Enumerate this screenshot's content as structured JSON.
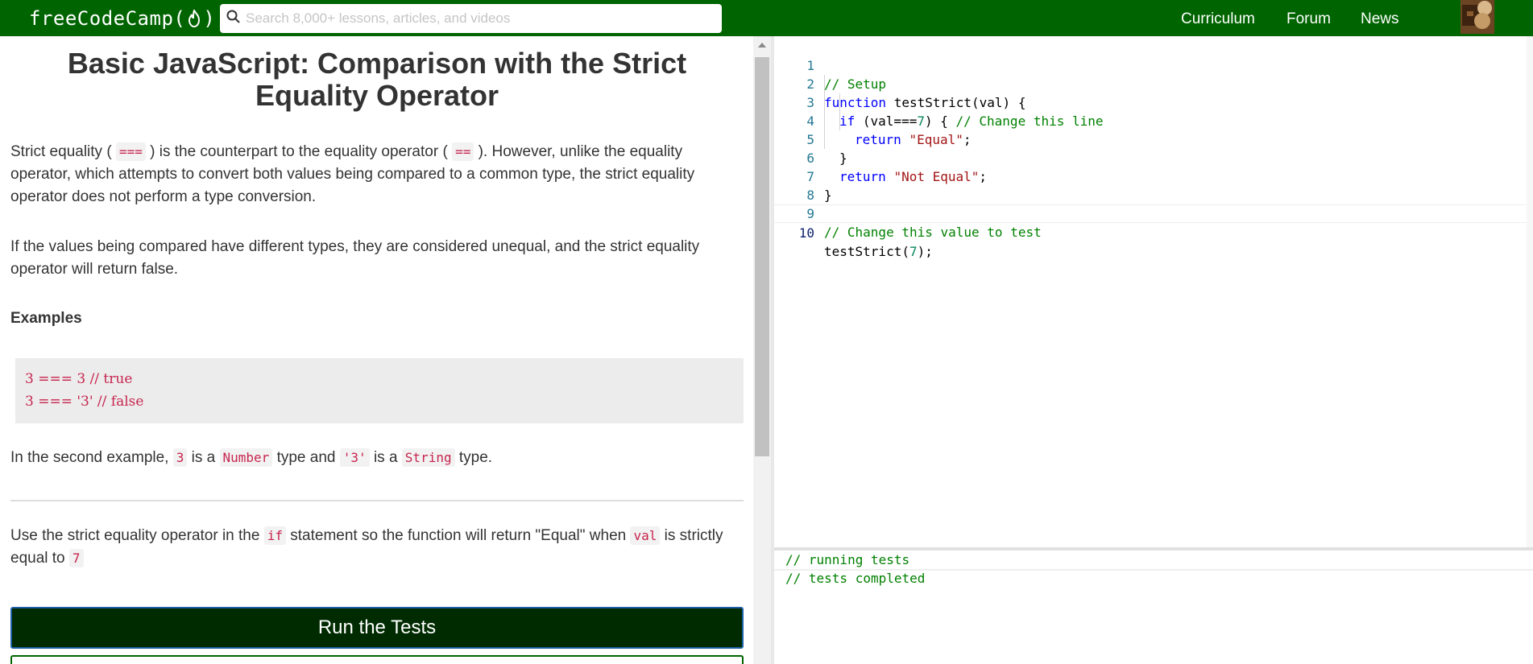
{
  "navbar": {
    "logo_text": "freeCodeCamp(",
    "logo_close": ")",
    "search_placeholder": "Search 8,000+ lessons, articles, and videos",
    "links": [
      "Curriculum",
      "Forum",
      "News"
    ]
  },
  "lesson": {
    "title": "Basic JavaScript: Comparison with the Strict Equality Operator",
    "p1_a": "Strict equality ( ",
    "p1_code1": "===",
    "p1_b": " ) is the counterpart to the equality operator ( ",
    "p1_code2": "==",
    "p1_c": " ). However, unlike the equality operator, which attempts to convert both values being compared to a common type, the strict equality operator does not perform a type conversion.",
    "p2": "If the values being compared have different types, they are considered unequal, and the strict equality operator will return false.",
    "examples_heading": "Examples",
    "code_line1": "3 === 3 // true",
    "code_line2": "3 === '3' // false",
    "p3_a": "In the second example, ",
    "p3_code1": "3",
    "p3_b": " is a ",
    "p3_code2": "Number",
    "p3_c": " type and ",
    "p3_code3": "'3'",
    "p3_d": " is a ",
    "p3_code4": "String",
    "p3_e": " type.",
    "p4_a": "Use the strict equality operator in the ",
    "p4_code1": "if",
    "p4_b": " statement so the function will return \"Equal\" when ",
    "p4_code2": "val",
    "p4_c": " is strictly equal to ",
    "p4_code3": "7",
    "run_button": "Run the Tests"
  },
  "editor": {
    "line_numbers": [
      "1",
      "2",
      "3",
      "4",
      "5",
      "6",
      "7",
      "8",
      "9",
      "10"
    ],
    "l1": "// Setup",
    "l2_kw": "function",
    "l2_rest": " testStrict(val) {",
    "l3_kw": "if",
    "l3_a": " (val===",
    "l3_num": "7",
    "l3_b": ") { ",
    "l3_cm": "// Change this line",
    "l4_kw": "return",
    "l4_str": "\"Equal\"",
    "l4_end": ";",
    "l5": "}",
    "l6_kw": "return",
    "l6_str": "\"Not Equal\"",
    "l6_end": ";",
    "l7": "}",
    "l9": "// Change this value to test",
    "l10_a": "testStrict(",
    "l10_num": "7",
    "l10_b": ");"
  },
  "console": {
    "line1": "// running tests",
    "line2": "// tests completed"
  },
  "colors": {
    "navbar": "#006400",
    "run_button": "#002b00",
    "code_red": "#c7254e"
  }
}
